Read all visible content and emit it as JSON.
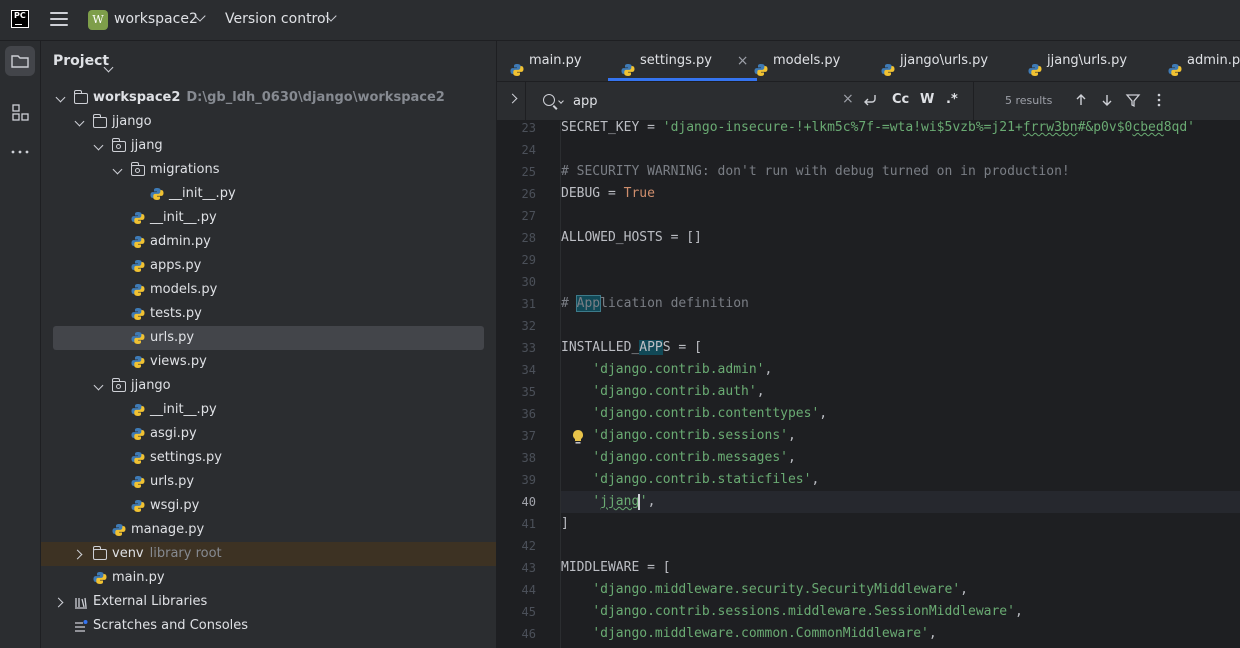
{
  "topbar": {
    "logo": "PC",
    "workspace_badge": "W",
    "workspace_name": "workspace2",
    "vcs_label": "Version control",
    "accent": "#7e9e4a"
  },
  "leftstrip": {
    "icons": [
      "folder-icon",
      "structure-icon",
      "more-icon"
    ]
  },
  "project": {
    "title": "Project",
    "tree": [
      {
        "label": "workspace2",
        "sub": "D:\\gb_ldh_0630\\django\\workspace2",
        "type": "folder",
        "depth": 0,
        "expanded": true,
        "bold": true
      },
      {
        "label": "jjango",
        "type": "folder",
        "depth": 1,
        "expanded": true
      },
      {
        "label": "jjang",
        "type": "package",
        "depth": 2,
        "expanded": true
      },
      {
        "label": "migrations",
        "type": "package",
        "depth": 3,
        "expanded": true
      },
      {
        "label": "__init__.py",
        "type": "py",
        "depth": 4
      },
      {
        "label": "__init__.py",
        "type": "py",
        "depth": 3
      },
      {
        "label": "admin.py",
        "type": "py",
        "depth": 3
      },
      {
        "label": "apps.py",
        "type": "py",
        "depth": 3
      },
      {
        "label": "models.py",
        "type": "py",
        "depth": 3
      },
      {
        "label": "tests.py",
        "type": "py",
        "depth": 3
      },
      {
        "label": "urls.py",
        "type": "py",
        "depth": 3,
        "selected": true
      },
      {
        "label": "views.py",
        "type": "py",
        "depth": 3
      },
      {
        "label": "jjango",
        "type": "package",
        "depth": 2,
        "expanded": true
      },
      {
        "label": "__init__.py",
        "type": "py",
        "depth": 3
      },
      {
        "label": "asgi.py",
        "type": "py",
        "depth": 3
      },
      {
        "label": "settings.py",
        "type": "py",
        "depth": 3
      },
      {
        "label": "urls.py",
        "type": "py",
        "depth": 3
      },
      {
        "label": "wsgi.py",
        "type": "py",
        "depth": 3
      },
      {
        "label": "manage.py",
        "type": "py",
        "depth": 2
      },
      {
        "label": "venv",
        "sub": "library root",
        "type": "folder",
        "depth": 1,
        "expanded": false,
        "libroot": true
      },
      {
        "label": "main.py",
        "type": "py",
        "depth": 1
      },
      {
        "label": "External Libraries",
        "type": "library",
        "depth": 0,
        "expanded": false
      },
      {
        "label": "Scratches and Consoles",
        "type": "scratch",
        "depth": 0,
        "noarrow": true
      }
    ]
  },
  "tabs": [
    {
      "label": "main.py"
    },
    {
      "label": "settings.py",
      "active": true,
      "close": "×"
    },
    {
      "label": "models.py"
    },
    {
      "label": "jjango\\urls.py"
    },
    {
      "label": "jjang\\urls.py"
    },
    {
      "label": "admin.py"
    }
  ],
  "find": {
    "query": "app",
    "clear": "×",
    "options": [
      "Cc",
      "W",
      ".*"
    ],
    "results": "5 results"
  },
  "code": {
    "current_line": 40,
    "lines": [
      {
        "n": "23",
        "tokens": [
          {
            "t": "SECRET_KEY = ",
            "c": "tok-id"
          },
          {
            "t": "'django-insecure-!+lkm5c%7f-=wta!wi$5vzb%=j21+",
            "c": "tok-str"
          },
          {
            "t": "frrw3bn",
            "c": "tok-str squig"
          },
          {
            "t": "#&p0v$0",
            "c": "tok-str"
          },
          {
            "t": "cbed",
            "c": "tok-str squig"
          },
          {
            "t": "8qd'",
            "c": "tok-str"
          }
        ]
      },
      {
        "n": "24",
        "tokens": []
      },
      {
        "n": "25",
        "tokens": [
          {
            "t": "# SECURITY WARNING: don't run with debug turned on in production!",
            "c": "tok-com"
          }
        ]
      },
      {
        "n": "26",
        "tokens": [
          {
            "t": "DEBUG = ",
            "c": "tok-id"
          },
          {
            "t": "True",
            "c": "tok-kw"
          }
        ]
      },
      {
        "n": "27",
        "tokens": []
      },
      {
        "n": "28",
        "tokens": [
          {
            "t": "ALLOWED_HOSTS = []",
            "c": "tok-id"
          }
        ]
      },
      {
        "n": "29",
        "tokens": []
      },
      {
        "n": "30",
        "tokens": []
      },
      {
        "n": "31",
        "tokens": [
          {
            "t": "# ",
            "c": "tok-com"
          },
          {
            "t": "App",
            "c": "tok-com hl"
          },
          {
            "t": "lication definition",
            "c": "tok-com"
          }
        ]
      },
      {
        "n": "32",
        "tokens": []
      },
      {
        "n": "33",
        "tokens": [
          {
            "t": "INSTALLED_",
            "c": "tok-id"
          },
          {
            "t": "APP",
            "c": "tok-id hl2"
          },
          {
            "t": "S = [",
            "c": "tok-id"
          }
        ]
      },
      {
        "n": "34",
        "tokens": [
          {
            "t": "    ",
            "c": "tok-id"
          },
          {
            "t": "'django.contrib.admin'",
            "c": "tok-str"
          },
          {
            "t": ",",
            "c": "tok-id"
          }
        ]
      },
      {
        "n": "35",
        "tokens": [
          {
            "t": "    ",
            "c": "tok-id"
          },
          {
            "t": "'django.contrib.auth'",
            "c": "tok-str"
          },
          {
            "t": ",",
            "c": "tok-id"
          }
        ]
      },
      {
        "n": "36",
        "tokens": [
          {
            "t": "    ",
            "c": "tok-id"
          },
          {
            "t": "'django.contrib.contenttypes'",
            "c": "tok-str"
          },
          {
            "t": ",",
            "c": "tok-id"
          }
        ]
      },
      {
        "n": "37",
        "tokens": [
          {
            "t": "    ",
            "c": "tok-id"
          },
          {
            "t": "'django.contrib.sessions'",
            "c": "tok-str"
          },
          {
            "t": ",",
            "c": "tok-id"
          }
        ]
      },
      {
        "n": "38",
        "tokens": [
          {
            "t": "    ",
            "c": "tok-id"
          },
          {
            "t": "'django.contrib.messages'",
            "c": "tok-str"
          },
          {
            "t": ",",
            "c": "tok-id"
          }
        ]
      },
      {
        "n": "39",
        "tokens": [
          {
            "t": "    ",
            "c": "tok-id"
          },
          {
            "t": "'django.contrib.staticfiles'",
            "c": "tok-str"
          },
          {
            "t": ",",
            "c": "tok-id"
          }
        ]
      },
      {
        "n": "40",
        "tokens": [
          {
            "t": "    ",
            "c": "tok-id"
          },
          {
            "t": "'",
            "c": "tok-str"
          },
          {
            "t": "jjang",
            "c": "tok-str squig"
          },
          {
            "t": "|",
            "c": "caret"
          },
          {
            "t": "'",
            "c": "tok-str"
          },
          {
            "t": ",",
            "c": "tok-id"
          }
        ]
      },
      {
        "n": "41",
        "tokens": [
          {
            "t": "]",
            "c": "tok-id"
          }
        ]
      },
      {
        "n": "42",
        "tokens": []
      },
      {
        "n": "43",
        "tokens": [
          {
            "t": "MIDDLEWARE = [",
            "c": "tok-id"
          }
        ]
      },
      {
        "n": "44",
        "tokens": [
          {
            "t": "    ",
            "c": "tok-id"
          },
          {
            "t": "'django.middleware.security.SecurityMiddleware'",
            "c": "tok-str"
          },
          {
            "t": ",",
            "c": "tok-id"
          }
        ]
      },
      {
        "n": "45",
        "tokens": [
          {
            "t": "    ",
            "c": "tok-id"
          },
          {
            "t": "'django.contrib.sessions.middleware.SessionMiddleware'",
            "c": "tok-str"
          },
          {
            "t": ",",
            "c": "tok-id"
          }
        ]
      },
      {
        "n": "46",
        "tokens": [
          {
            "t": "    ",
            "c": "tok-id"
          },
          {
            "t": "'django.middleware.common.CommonMiddleware'",
            "c": "tok-str"
          },
          {
            "t": ",",
            "c": "tok-id"
          }
        ]
      }
    ]
  }
}
